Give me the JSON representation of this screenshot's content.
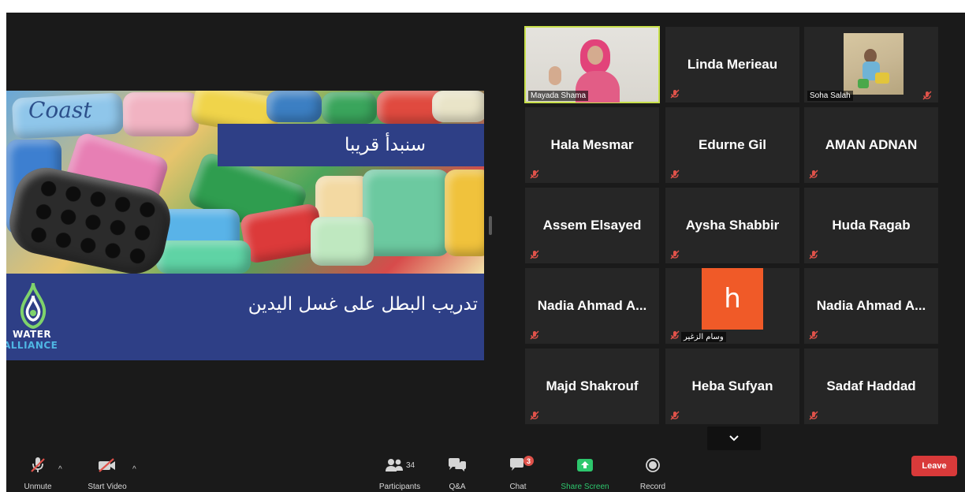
{
  "slide": {
    "title": "سنبدأ قريبا",
    "subtitle": "تدريب البطل على غسل اليدين",
    "logo_line1": "WATER",
    "logo_line2": "ALLIANCE",
    "soap_text": "Coast"
  },
  "participants": [
    {
      "name": "Mayada Shama",
      "type": "video",
      "active": true
    },
    {
      "name": "Linda Merieau",
      "type": "name"
    },
    {
      "name": "Soha Salah",
      "type": "photo"
    },
    {
      "name": "Hala Mesmar",
      "type": "name"
    },
    {
      "name": "Edurne Gil",
      "type": "name"
    },
    {
      "name": "AMAN ADNAN",
      "type": "name"
    },
    {
      "name": "Assem Elsayed",
      "type": "name"
    },
    {
      "name": "Aysha Shabbir",
      "type": "name"
    },
    {
      "name": "Huda Ragab",
      "type": "name"
    },
    {
      "name": "Nadia Ahmad A...",
      "type": "name"
    },
    {
      "name": "وسام الزغير",
      "type": "avatar",
      "avatar_letter": "h"
    },
    {
      "name": "Nadia Ahmad A...",
      "type": "name"
    },
    {
      "name": "Majd Shakrouf",
      "type": "name"
    },
    {
      "name": "Heba Sufyan",
      "type": "name"
    },
    {
      "name": "Sadaf Haddad",
      "type": "name"
    }
  ],
  "toolbar": {
    "unmute": "Unmute",
    "start_video": "Start Video",
    "participants": "Participants",
    "participants_count": "34",
    "qa": "Q&A",
    "chat": "Chat",
    "chat_badge": "3",
    "share_screen": "Share Screen",
    "record": "Record",
    "leave": "Leave"
  },
  "colors": {
    "accent_green": "#2dc76d",
    "leave_red": "#d93a3a",
    "active_border": "#c8e04b",
    "muted_red": "#e0524a",
    "avatar_orange": "#f05a28",
    "slide_blue": "#2e3f86"
  }
}
